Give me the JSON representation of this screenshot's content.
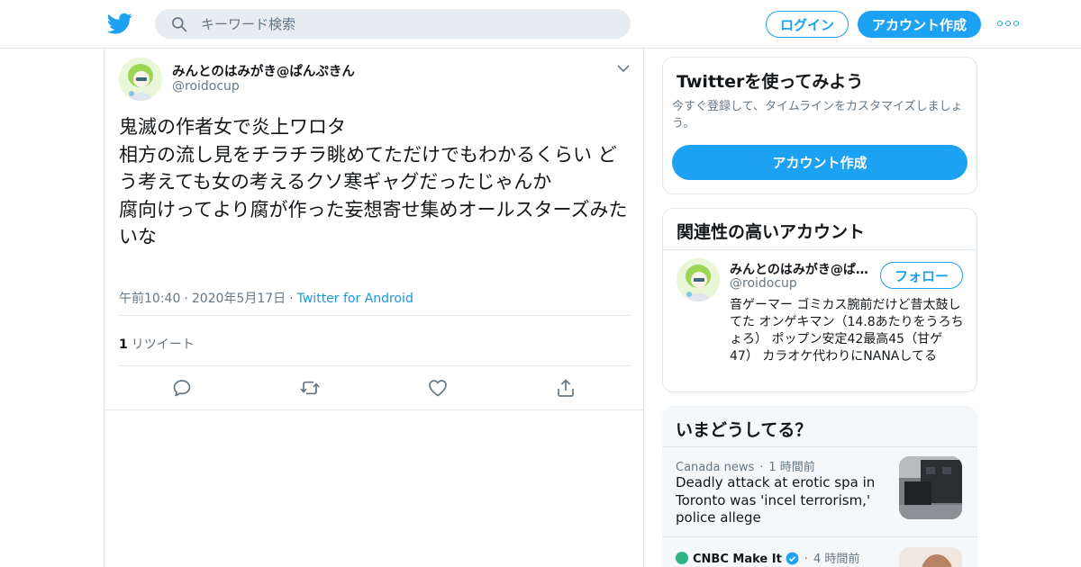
{
  "header": {
    "search_placeholder": "キーワード検索",
    "login_label": "ログイン",
    "signup_label": "アカウント作成"
  },
  "tweet": {
    "display_name": "みんとのはみがき@ぱんぷきん",
    "handle": "@roidocup",
    "text": "鬼滅の作者女で炎上ワロタ\n相方の流し見をチラチラ眺めてただけでもわかるくらい どう考えても女の考えるクソ寒ギャグだったじゃんか\n腐向けってより腐が作った妄想寄せ集めオールスターズみたいな",
    "time": "午前10:40",
    "date": "2020年5月17日",
    "source": "Twitter for Android",
    "retweet_count": "1",
    "retweet_label": "リツイート"
  },
  "sidebar": {
    "signup_card": {
      "title": "Twitterを使ってみよう",
      "description": "今すぐ登録して、タイムラインをカスタマイズしましょう。",
      "button_label": "アカウント作成"
    },
    "related_card": {
      "title": "関連性の高いアカウント",
      "name": "みんとのはみがき@ぱんぷきん",
      "handle": "@roidocup",
      "follow_label": "フォロー",
      "bio": "音ゲーマー ゴミカス腕前だけど昔太鼓してた オンゲキマン（14.8あたりをうろちょろ） ポップン安定42最高45（甘ゲ47） カラオケ代わりにNANAしてる"
    },
    "trends_card": {
      "title": "いまどうしてる？",
      "items": [
        {
          "category": "Canada news",
          "time": "1 時間前",
          "title": "Deadly attack at erotic spa in Toronto was 'incel terrorism,' police allege"
        },
        {
          "category": "CNBC Make It",
          "time": "4 時間前"
        }
      ]
    }
  },
  "colors": {
    "brand": "#1da1f2",
    "text_secondary": "#657786",
    "border": "#e1e8ed"
  }
}
